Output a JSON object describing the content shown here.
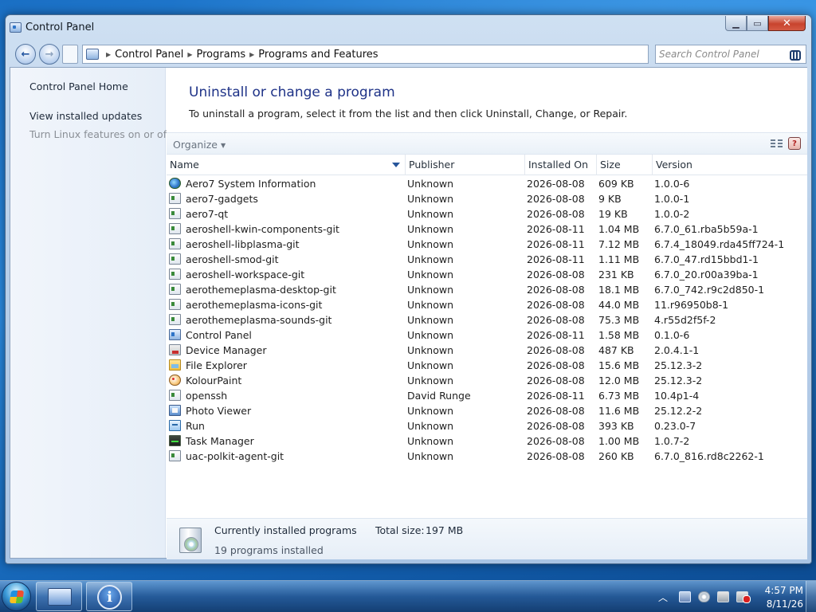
{
  "window": {
    "title": "Control Panel",
    "buttons": {
      "minimize": "▁",
      "maximize": "▭",
      "close": "✕"
    }
  },
  "nav": {
    "back_icon": "arrow-left-icon",
    "forward_icon": "arrow-right-icon",
    "breadcrumb": [
      "Control Panel",
      "Programs",
      "Programs and Features"
    ],
    "search_placeholder": "Search Control Panel"
  },
  "sidebar": {
    "items": [
      {
        "label": "Control Panel Home",
        "enabled": true
      },
      {
        "label": "View installed updates",
        "enabled": true
      },
      {
        "label": "Turn Linux features on or off",
        "enabled": false
      }
    ]
  },
  "main": {
    "heading": "Uninstall or change a program",
    "subtext": "To uninstall a program, select it from the list and then click Uninstall, Change, or Repair.",
    "organize_label": "Organize",
    "columns": [
      "Name",
      "Publisher",
      "Installed On",
      "Size",
      "Version"
    ],
    "sorted_column": "Name",
    "programs": [
      {
        "name": "Aero7 System Information",
        "publisher": "Unknown",
        "installed": "2026-08-08",
        "size": "609 KB",
        "version": "1.0.0-6",
        "icon": "globe-icon"
      },
      {
        "name": "aero7-gadgets",
        "publisher": "Unknown",
        "installed": "2026-08-08",
        "size": "9 KB",
        "version": "1.0.0-1",
        "icon": "package-icon"
      },
      {
        "name": "aero7-qt",
        "publisher": "Unknown",
        "installed": "2026-08-08",
        "size": "19 KB",
        "version": "1.0.0-2",
        "icon": "package-icon"
      },
      {
        "name": "aeroshell-kwin-components-git",
        "publisher": "Unknown",
        "installed": "2026-08-11",
        "size": "1.04 MB",
        "version": "6.7.0_61.rba5b59a-1",
        "icon": "package-icon"
      },
      {
        "name": "aeroshell-libplasma-git",
        "publisher": "Unknown",
        "installed": "2026-08-11",
        "size": "7.12 MB",
        "version": "6.7.4_18049.rda45ff724-1",
        "icon": "package-icon"
      },
      {
        "name": "aeroshell-smod-git",
        "publisher": "Unknown",
        "installed": "2026-08-11",
        "size": "1.11 MB",
        "version": "6.7.0_47.rd15bbd1-1",
        "icon": "package-icon"
      },
      {
        "name": "aeroshell-workspace-git",
        "publisher": "Unknown",
        "installed": "2026-08-08",
        "size": "231 KB",
        "version": "6.7.0_20.r00a39ba-1",
        "icon": "package-icon"
      },
      {
        "name": "aerothemeplasma-desktop-git",
        "publisher": "Unknown",
        "installed": "2026-08-08",
        "size": "18.1 MB",
        "version": "6.7.0_742.r9c2d850-1",
        "icon": "package-icon"
      },
      {
        "name": "aerothemeplasma-icons-git",
        "publisher": "Unknown",
        "installed": "2026-08-08",
        "size": "44.0 MB",
        "version": "11.r96950b8-1",
        "icon": "package-icon"
      },
      {
        "name": "aerothemeplasma-sounds-git",
        "publisher": "Unknown",
        "installed": "2026-08-08",
        "size": "75.3 MB",
        "version": "4.r55d2f5f-2",
        "icon": "package-icon"
      },
      {
        "name": "Control Panel",
        "publisher": "Unknown",
        "installed": "2026-08-11",
        "size": "1.58 MB",
        "version": "0.1.0-6",
        "icon": "control-panel-icon"
      },
      {
        "name": "Device Manager",
        "publisher": "Unknown",
        "installed": "2026-08-08",
        "size": "487 KB",
        "version": "2.0.4.1-1",
        "icon": "device-manager-icon"
      },
      {
        "name": "File Explorer",
        "publisher": "Unknown",
        "installed": "2026-08-08",
        "size": "15.6 MB",
        "version": "25.12.3-2",
        "icon": "folder-icon"
      },
      {
        "name": "KolourPaint",
        "publisher": "Unknown",
        "installed": "2026-08-08",
        "size": "12.0 MB",
        "version": "25.12.3-2",
        "icon": "paint-icon"
      },
      {
        "name": "openssh",
        "publisher": "David Runge",
        "installed": "2026-08-11",
        "size": "6.73 MB",
        "version": "10.4p1-4",
        "icon": "package-icon"
      },
      {
        "name": "Photo Viewer",
        "publisher": "Unknown",
        "installed": "2026-08-08",
        "size": "11.6 MB",
        "version": "25.12.2-2",
        "icon": "photo-icon"
      },
      {
        "name": "Run",
        "publisher": "Unknown",
        "installed": "2026-08-08",
        "size": "393 KB",
        "version": "0.23.0-7",
        "icon": "run-icon"
      },
      {
        "name": "Task Manager",
        "publisher": "Unknown",
        "installed": "2026-08-08",
        "size": "1.00 MB",
        "version": "1.0.7-2",
        "icon": "task-manager-icon"
      },
      {
        "name": "uac-polkit-agent-git",
        "publisher": "Unknown",
        "installed": "2026-08-08",
        "size": "260 KB",
        "version": "6.7.0_816.rd8c2262-1",
        "icon": "package-icon"
      }
    ]
  },
  "status": {
    "title": "Currently installed programs",
    "total_label": "Total size:",
    "total_value": "197 MB",
    "count": "19 programs installed"
  },
  "taskbar": {
    "clock_time": "4:57 PM",
    "clock_date": "8/11/26",
    "tray_icons": [
      "network-icon",
      "disc-icon",
      "device-icon",
      "volume-muted-icon"
    ]
  },
  "colors": {
    "heading": "#1e3287",
    "desktop": "#1a6fc4",
    "sort_arrow": "#27569b"
  }
}
